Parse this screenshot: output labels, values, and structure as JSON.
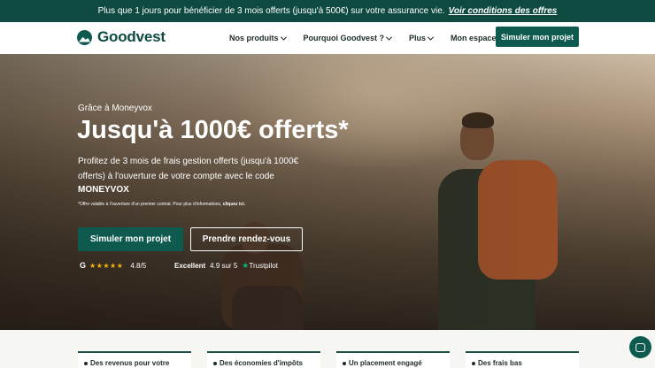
{
  "promo": {
    "text": "Plus que 1 jours pour bénéficier de 3 mois offerts (jusqu'à 500€) sur votre assurance vie.",
    "link": "Voir conditions des offres"
  },
  "header": {
    "logo": "Goodvest",
    "nav": [
      {
        "label": "Nos produits",
        "dropdown": true
      },
      {
        "label": "Pourquoi Goodvest ?",
        "dropdown": true
      },
      {
        "label": "Plus",
        "dropdown": true
      },
      {
        "label": "Mon espace",
        "dropdown": false
      }
    ],
    "cta": "Simuler mon projet"
  },
  "hero": {
    "eyebrow": "Grâce à Moneyvox",
    "title": "Jusqu'à 1000€ offerts*",
    "description": "Profitez de 3 mois de frais gestion offerts (jusqu'à 1000€ offerts) à l'ouverture de votre compte avec le code",
    "code": "MONEYVOX",
    "disclaimer": "*Offre valable à l'ouverture d'un premier contrat. Pour plus d'informations,",
    "disclaimer_link": "cliquez ici.",
    "primary_button": "Simuler mon projet",
    "secondary_button": "Prendre rendez-vous",
    "google_rating": {
      "stars": "★★★★★",
      "score": "4.8/5"
    },
    "trustpilot": {
      "label": "Excellent",
      "score": "4.9 sur 5",
      "brand": "Trustpilot"
    }
  },
  "features": [
    "Des revenus pour votre",
    "Des économies d'impôts",
    "Un placement engagé",
    "Des frais bas"
  ],
  "colors": {
    "brand_green": "#0e5a4e",
    "dark_green": "#0e4a40",
    "star_gold": "#f5b50a",
    "trustpilot_green": "#00b67a"
  },
  "icons": [
    "logo-mountain-icon",
    "chevron-down-icon",
    "google-icon",
    "trustpilot-star-icon",
    "chat-icon"
  ]
}
